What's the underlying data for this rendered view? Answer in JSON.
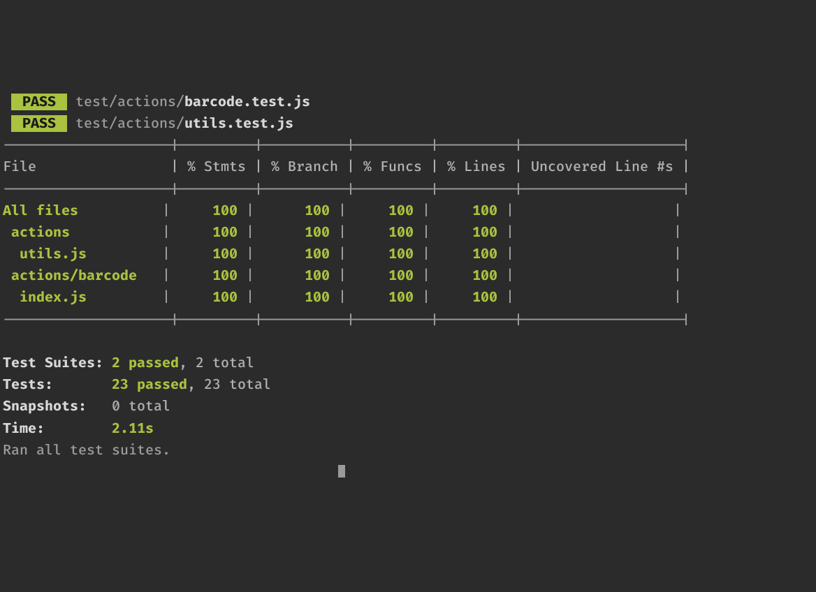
{
  "tests_run": [
    {
      "status": "PASS",
      "path": "test/actions/",
      "file": "barcode.test.js"
    },
    {
      "status": "PASS",
      "path": "test/actions/",
      "file": "utils.test.js"
    }
  ],
  "coverage": {
    "hr": "--------------------|---------|----------|---------|---------|-------------------|",
    "header": "File                | % Stmts | % Branch | % Funcs | % Lines | Uncovered Line #s |",
    "rows": [
      {
        "file": "All files          ",
        "s": "100",
        "b": "100",
        "f": "100",
        "l": "100",
        "u": "                  "
      },
      {
        "file": " actions           ",
        "s": "100",
        "b": "100",
        "f": "100",
        "l": "100",
        "u": "                  "
      },
      {
        "file": "  utils.js         ",
        "s": "100",
        "b": "100",
        "f": "100",
        "l": "100",
        "u": "                  "
      },
      {
        "file": " actions/barcode   ",
        "s": "100",
        "b": "100",
        "f": "100",
        "l": "100",
        "u": "                  "
      },
      {
        "file": "  index.js         ",
        "s": "100",
        "b": "100",
        "f": "100",
        "l": "100",
        "u": "                  "
      }
    ]
  },
  "summary": {
    "suites_label": "Test Suites: ",
    "suites_passed": "2 passed",
    "suites_total": ", 2 total",
    "tests_label": "Tests:       ",
    "tests_passed": "23 passed",
    "tests_total": ", 23 total",
    "snapshots_label": "Snapshots:   ",
    "snapshots_value": "0 total",
    "time_label": "Time:        ",
    "time_value": "2.11s",
    "ran_line": "Ran all test suites."
  }
}
